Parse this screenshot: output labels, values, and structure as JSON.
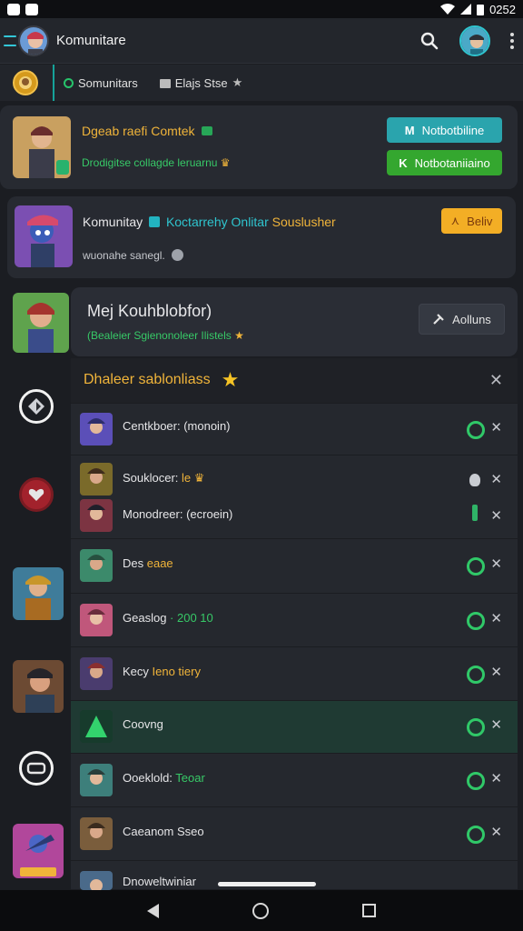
{
  "status_bar": {
    "time": "0252"
  },
  "app_bar": {
    "title": "Komunitare",
    "icons": [
      "menu-icon",
      "search-icon",
      "profile-avatar",
      "more-vert-icon"
    ]
  },
  "sub_bar": {
    "tabs": [
      {
        "label": "Somunitars",
        "icon": "community-dot-icon"
      },
      {
        "label": "Elajs Stse",
        "icon": "star-icon"
      }
    ]
  },
  "card1": {
    "title": "Dgeab raefi Comtek",
    "subtitle": "Drodigitse collagde leruarnu",
    "buttons": [
      "Notbotbiline",
      "Notbotaniiaino"
    ]
  },
  "card2": {
    "title_a": "Komunitay",
    "title_b": "Koctarrehy Onlitar",
    "title_c": "Souslusher",
    "subtitle": "wuonahe sanegl.",
    "button": "Beliv"
  },
  "card3": {
    "title": "Mej Kouhblobfor)",
    "subtitle": "(Bealeier Sgienonoleer Ilistels",
    "button": "Aolluns"
  },
  "panel": {
    "title": "Dhaleer sablonliass",
    "rows": [
      {
        "text": "Centkboer: (monoin)",
        "accent": ""
      },
      {
        "text": "Souklocer: ",
        "accent": "le"
      },
      {
        "text": "Monodreer: (ecroein)",
        "accent": ""
      },
      {
        "text": "Des ",
        "accent": "eaae"
      },
      {
        "text": "Geaslog",
        "accent": "· 200 10"
      },
      {
        "text": "Kecy ",
        "accent": "Ieno tiery"
      },
      {
        "text": "Coovng",
        "accent": ""
      },
      {
        "text": "Ooeklold: ",
        "accent": "Teoar"
      },
      {
        "text": "Caeanom Sseo",
        "accent": ""
      },
      {
        "text": "Dnoweltwiniar",
        "accent": ""
      }
    ]
  },
  "colors": {
    "accent_teal": "#2aa4ad",
    "accent_green": "#34a72f",
    "accent_gold": "#f3ae25",
    "background": "#1b1d22"
  }
}
